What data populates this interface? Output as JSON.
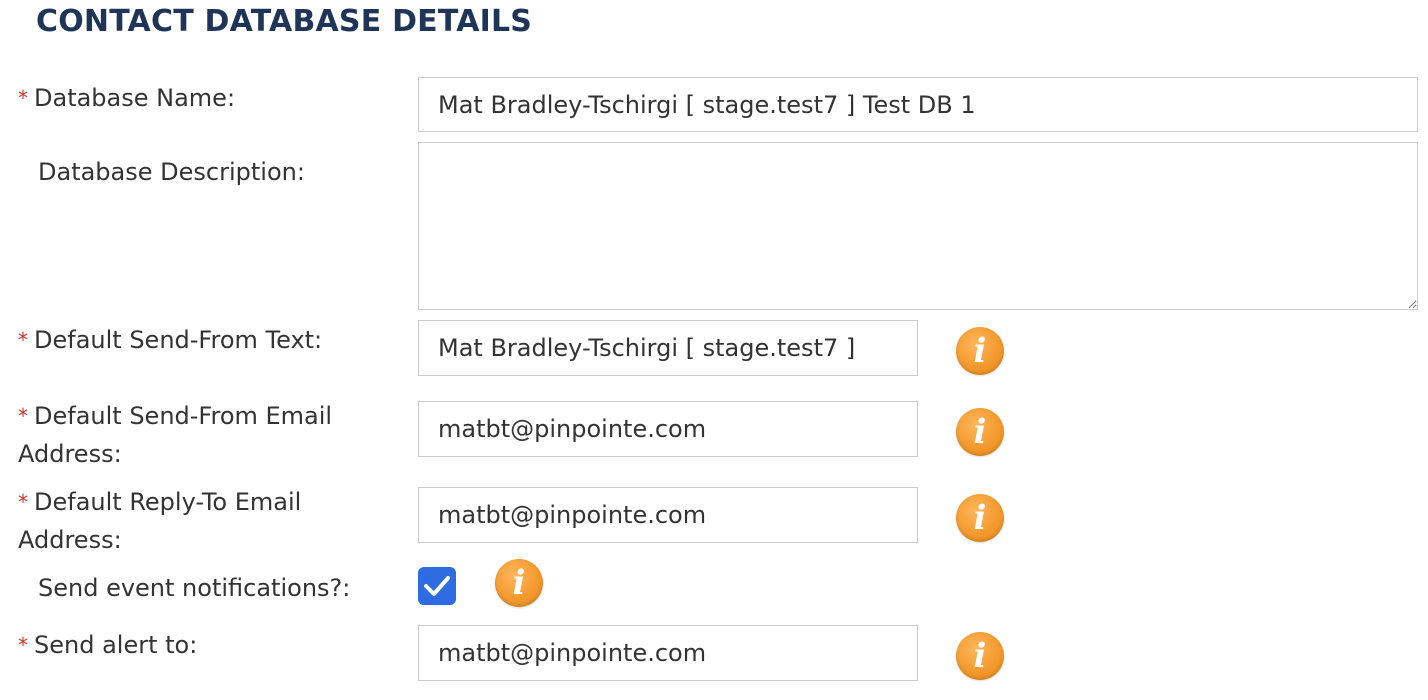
{
  "section": {
    "title": "CONTACT DATABASE DETAILS"
  },
  "required_marker": "*",
  "fields": {
    "database_name": {
      "label": "Database Name:",
      "value": "Mat Bradley-Tschirgi [ stage.test7 ] Test DB 1"
    },
    "database_description": {
      "label": "Database Description:",
      "value": ""
    },
    "send_from_text": {
      "label": "Default Send-From Text:",
      "value": "Mat Bradley-Tschirgi [ stage.test7 ]"
    },
    "send_from_email": {
      "label": "Default Send-From Email Address:",
      "value": "matbt@pinpointe.com"
    },
    "reply_to_email": {
      "label": "Default Reply-To Email Address:",
      "value": "matbt@pinpointe.com"
    },
    "event_notifications": {
      "label": "Send event notifications?:",
      "checked": true
    },
    "alert_to": {
      "label": "Send alert to:",
      "value": "matbt@pinpointe.com"
    }
  },
  "info_icon": {
    "glyph": "i",
    "name": "info-icon",
    "color": "#f39a2e"
  },
  "colors": {
    "title": "#1f3557",
    "required": "#d0342c",
    "checkbox": "#2f6be0",
    "border": "#cccccc"
  }
}
